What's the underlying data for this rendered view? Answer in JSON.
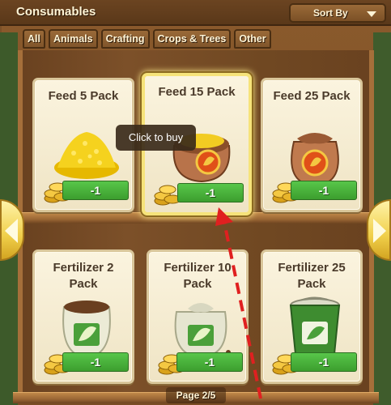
{
  "header": {
    "title": "Consumables",
    "sort_label": "Sort By"
  },
  "tabs": [
    "All",
    "Animals",
    "Crafting",
    "Crops & Trees",
    "Other"
  ],
  "items": [
    {
      "name": "Feed 5 Pack",
      "price": "-1",
      "icon": "feed-pile-icon"
    },
    {
      "name": "Feed 15 Pack",
      "price": "-1",
      "icon": "feed-sack-open-icon"
    },
    {
      "name": "Feed 25 Pack",
      "price": "-1",
      "icon": "feed-sack-tied-icon"
    },
    {
      "name": "Fertilizer 2 Pack",
      "price": "-1",
      "icon": "fertilizer-bag-open-icon"
    },
    {
      "name": "Fertilizer 10 Pack",
      "price": "-1",
      "icon": "fertilizer-bag-icon"
    },
    {
      "name": "Fertilizer 25 Pack",
      "price": "-1",
      "icon": "fertilizer-bucket-icon"
    }
  ],
  "tooltip": "Click to buy",
  "pagination": "Page 2/5",
  "colors": {
    "price_button": "#4caf3f",
    "highlight": "#f6e37a",
    "wood": "#7a4d24",
    "pointer_arrow": "#e02020"
  }
}
